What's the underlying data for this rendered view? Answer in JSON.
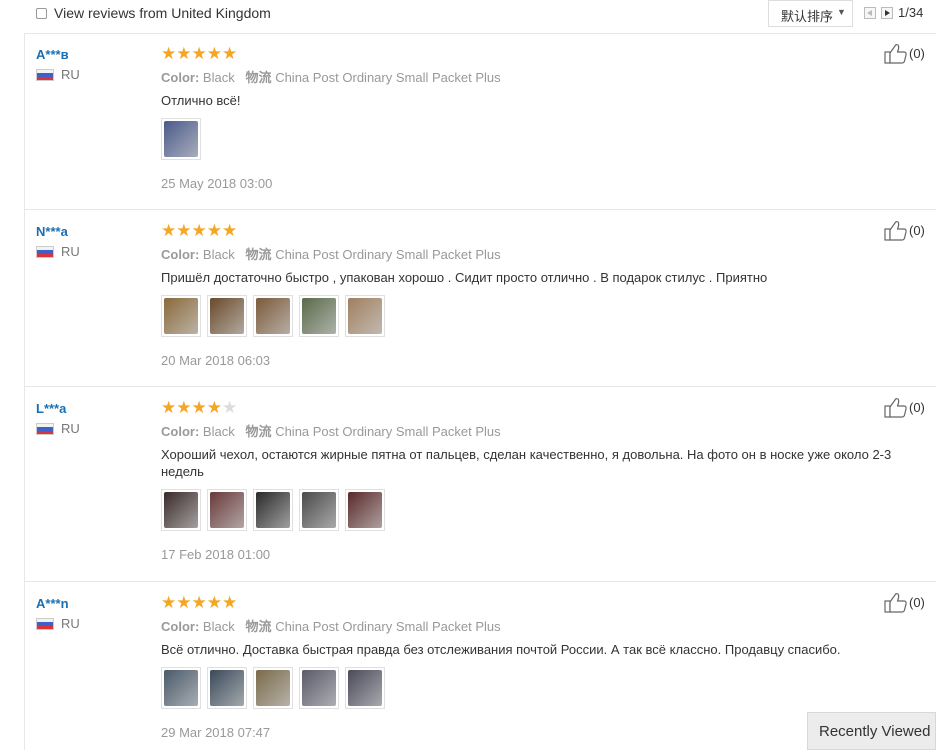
{
  "topbar": {
    "uk_filter_label": "View reviews from United Kingdom",
    "sort_label": "默认排序",
    "page_indicator": "1/34"
  },
  "labels": {
    "color_key": "Color:",
    "logistics_key": "物流"
  },
  "reviews": [
    {
      "user": "A***в",
      "country": "RU",
      "rating": 5,
      "color": "Black",
      "logistics": "China Post Ordinary Small Packet Plus",
      "text": "Отлично всё!",
      "photos": [
        "#4a5a8a"
      ],
      "date": "25 May 2018 03:00",
      "likes": "(0)"
    },
    {
      "user": "N***a",
      "country": "RU",
      "rating": 5,
      "color": "Black",
      "logistics": "China Post Ordinary Small Packet Plus",
      "text": "Пришёл достаточно быстро , упакован хорошо . Сидит просто отлично . В подарок стилус . Приятно",
      "photos": [
        "#8a6a3a",
        "#6a4a2a",
        "#7a5a3a",
        "#5a6a4a",
        "#a08060"
      ],
      "date": "20 Mar 2018 06:03",
      "likes": "(0)"
    },
    {
      "user": "L***a",
      "country": "RU",
      "rating": 4,
      "color": "Black",
      "logistics": "China Post Ordinary Small Packet Plus",
      "text": "Хороший чехол, остаются жирные пятна от пальцев, сделан качественно, я довольна. На фото он в носке уже около 2-3 недель",
      "photos": [
        "#3a2a2a",
        "#6a3a3a",
        "#2a2a2a",
        "#4a4a4a",
        "#5a2a2a"
      ],
      "date": "17 Feb 2018 01:00",
      "likes": "(0)"
    },
    {
      "user": "A***n",
      "country": "RU",
      "rating": 5,
      "color": "Black",
      "logistics": "China Post Ordinary Small Packet Plus",
      "text": "Всё отлично. Доставка быстрая правда без отслеживания почтой России. А так всё классно. Продавцу спасибо.",
      "photos": [
        "#4a5a6a",
        "#3a4a5a",
        "#7a6a4a",
        "#5a5a6a",
        "#4a4a5a"
      ],
      "date": "29 Mar 2018 07:47",
      "likes": "(0)"
    }
  ],
  "recently_viewed_label": "Recently Viewed"
}
